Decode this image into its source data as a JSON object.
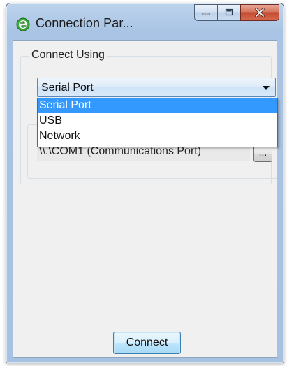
{
  "window": {
    "title": "Connection Par..."
  },
  "caption_buttons": {
    "minimize_icon": "minimize-icon",
    "maximize_icon": "maximize-icon",
    "close_icon": "close-icon"
  },
  "connect_using": {
    "label": "Connect Using",
    "selected": "Serial Port",
    "options": [
      "Serial Port",
      "USB",
      "Network"
    ]
  },
  "port": {
    "value": "\\\\.\\COM1 (Communications Port)",
    "browse_label": "..."
  },
  "actions": {
    "connect_label": "Connect"
  },
  "colors": {
    "selection": "#3399ff",
    "app_icon": "#3aa83a"
  }
}
